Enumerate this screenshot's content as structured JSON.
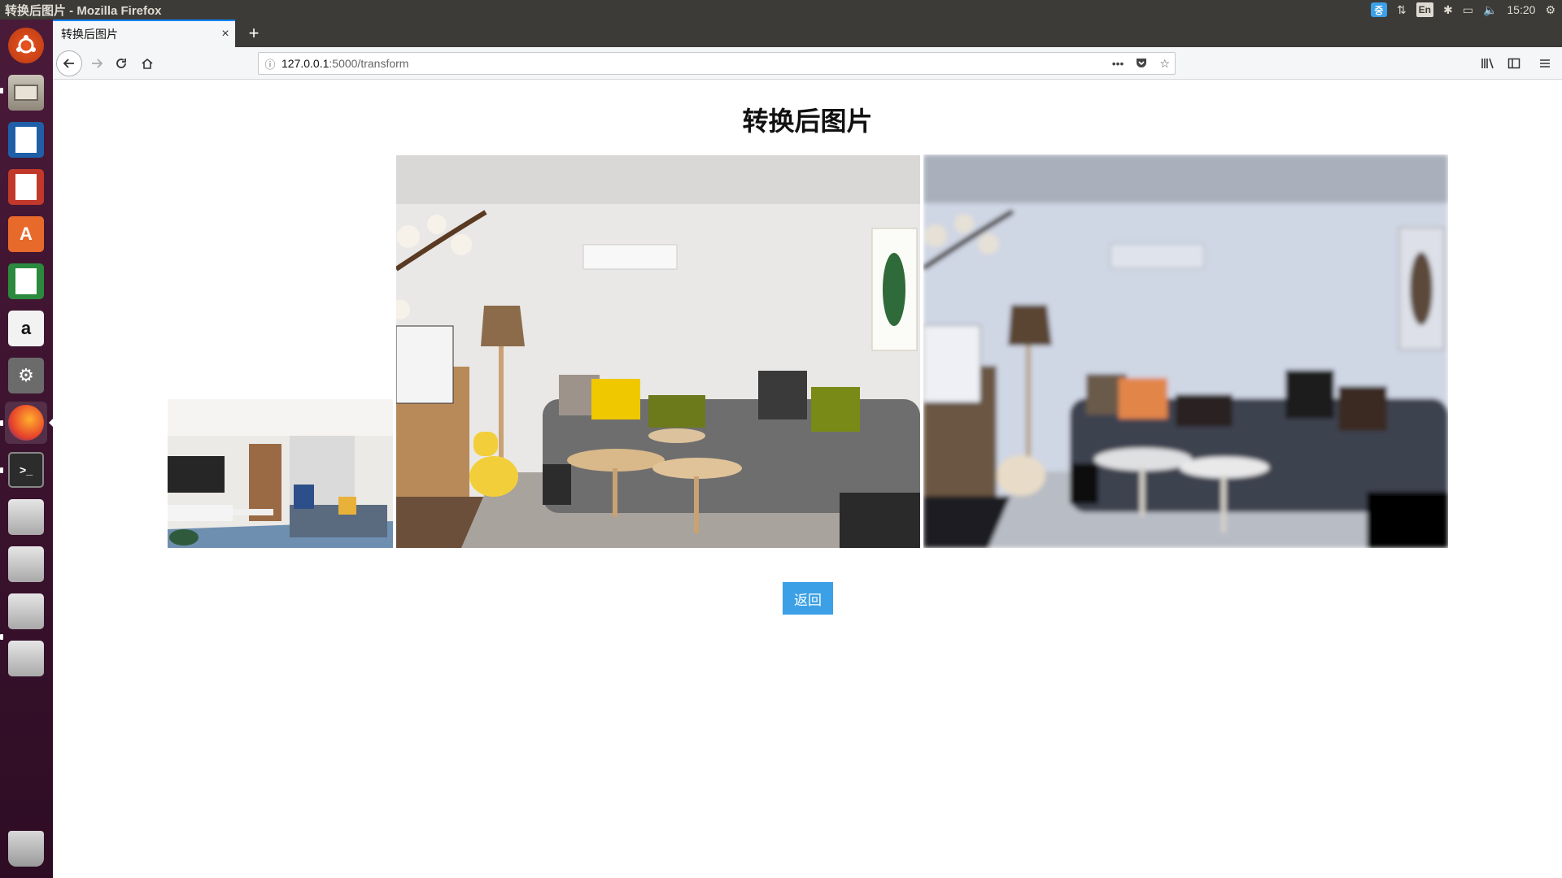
{
  "system": {
    "window_title": "转换后图片 - Mozilla Firefox",
    "tray_input_badge": "중",
    "tray_lang": "En",
    "clock": "15:20"
  },
  "browser": {
    "tab_title": "转换后图片",
    "tab_close": "×",
    "new_tab": "+",
    "url_host": "127.0.0.1",
    "url_path": ":5000/transform",
    "page_actions": "•••"
  },
  "page": {
    "title": "转换后图片",
    "return_button": "返回"
  },
  "launcher": {
    "items": [
      "ubuntu-dash-icon",
      "files-icon",
      "writer-icon",
      "impress-icon",
      "software-center-icon",
      "calc-icon",
      "amazon-icon",
      "settings-icon",
      "firefox-icon",
      "terminal-icon",
      "drive-icon",
      "drive-icon",
      "drive-icon",
      "drive-icon",
      "trash-icon"
    ]
  },
  "colors": {
    "accent": "#3ba0e6",
    "launcher": "#4a1a39",
    "firefox_tab_accent": "#0a84ff"
  }
}
